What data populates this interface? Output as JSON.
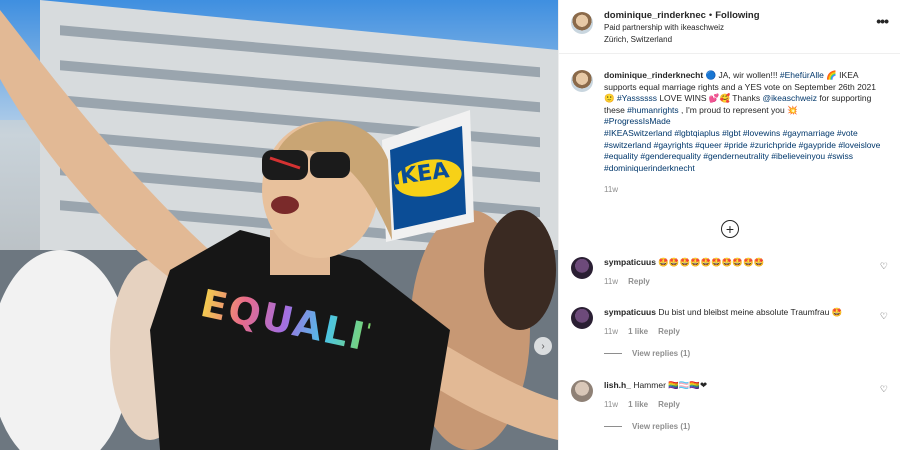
{
  "header": {
    "username": "dominique_rinderknec",
    "separator": "•",
    "follow_status": "Following",
    "partnership": "Paid partnership with ikeaschweiz",
    "location": "Zürich, Switzerland",
    "more_icon": "more-dots-icon"
  },
  "photo": {
    "shirt_text": "EQUALITY",
    "sign_text": "IKEA",
    "next_icon": "chevron-right-icon"
  },
  "caption": {
    "username": "dominique_rinderknecht",
    "lines": [
      " 🔵 JA, wir wollen!!! ",
      "#EhefürAlle",
      " 🌈 IKEA supports equal marriage rights and a YES vote on September 26th 2021 🙂 ",
      "#Yassssss",
      " LOVE WINS 💕🥰 Thanks ",
      "@ikeaschweiz",
      " for supporting these ",
      "#humanrights",
      " , I'm proud to represent you 💥 ",
      "#ProgressIsMade",
      "#IKEASwitzerland #lgbtqiaplus #lgbt #lovewins #gaymarriage #vote #switzerland #gayrights #queer #pride #zurichpride #gaypride #loveislove #equality #genderequality #genderneutrality #ibelieveinyou #swiss #dominiquerinderknecht"
    ],
    "time": "11w"
  },
  "load_more_icon": "plus-circle-icon",
  "comments": [
    {
      "username": "sympaticuus",
      "text": "🤩🤩🤩🤩🤩🤩🤩🤩🤩🤩",
      "time": "11w",
      "likes": "",
      "reply": "Reply",
      "view_replies": ""
    },
    {
      "username": "sympaticuus",
      "text": "Du bist und bleibst meine absolute Traumfrau 🤩",
      "time": "11w",
      "likes": "1 like",
      "reply": "Reply",
      "view_replies": "View replies (1)"
    },
    {
      "username": "lish.h_",
      "text": "Hammer 🏳️‍🌈🏳️‍⚧️🏳️‍🌈❤",
      "time": "11w",
      "likes": "1 like",
      "reply": "Reply",
      "view_replies": "View replies (1)"
    }
  ],
  "colors": {
    "link": "#00376b",
    "muted": "#8e8e8e",
    "text": "#262626"
  }
}
